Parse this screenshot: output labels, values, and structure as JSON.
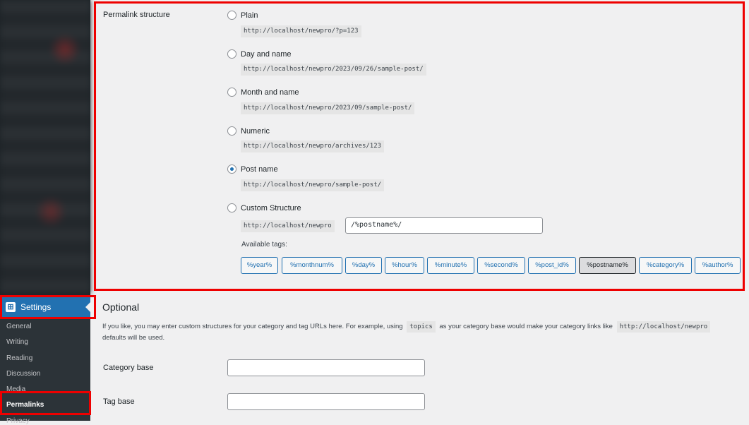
{
  "sidebar": {
    "settings_label": "Settings",
    "settings_icon_glyph": "⊞",
    "submenu": [
      "General",
      "Writing",
      "Reading",
      "Discussion",
      "Media",
      "Permalinks",
      "Privacy"
    ],
    "current": "Permalinks"
  },
  "permalink": {
    "heading": "Permalink structure",
    "options": [
      {
        "label": "Plain",
        "example": "http://localhost/newpro/?p=123",
        "checked": false
      },
      {
        "label": "Day and name",
        "example": "http://localhost/newpro/2023/09/26/sample-post/",
        "checked": false
      },
      {
        "label": "Month and name",
        "example": "http://localhost/newpro/2023/09/sample-post/",
        "checked": false
      },
      {
        "label": "Numeric",
        "example": "http://localhost/newpro/archives/123",
        "checked": false
      },
      {
        "label": "Post name",
        "example": "http://localhost/newpro/sample-post/",
        "checked": true
      },
      {
        "label": "Custom Structure",
        "example": "",
        "checked": false
      }
    ],
    "custom_prefix": "http://localhost/newpro",
    "custom_value": "/%postname%/",
    "available_tags_label": "Available tags:",
    "tags": [
      "%year%",
      "%monthnum%",
      "%day%",
      "%hour%",
      "%minute%",
      "%second%",
      "%post_id%",
      "%postname%",
      "%category%",
      "%author%"
    ],
    "active_tag": "%postname%"
  },
  "optional": {
    "title": "Optional",
    "desc_line1_a": "If you like, you may enter custom structures for your category and tag URLs here. For example, using",
    "desc_code1": "topics",
    "desc_line1_b": "as your category base would make your category links like",
    "desc_code2": "http://localhost/newpro",
    "desc_line2": "defaults will be used.",
    "category_base_label": "Category base",
    "category_base_value": "",
    "tag_base_label": "Tag base",
    "tag_base_value": ""
  },
  "colors": {
    "highlight": "#e00000",
    "accent": "#2271b1",
    "sidebar": "#1d2327"
  }
}
